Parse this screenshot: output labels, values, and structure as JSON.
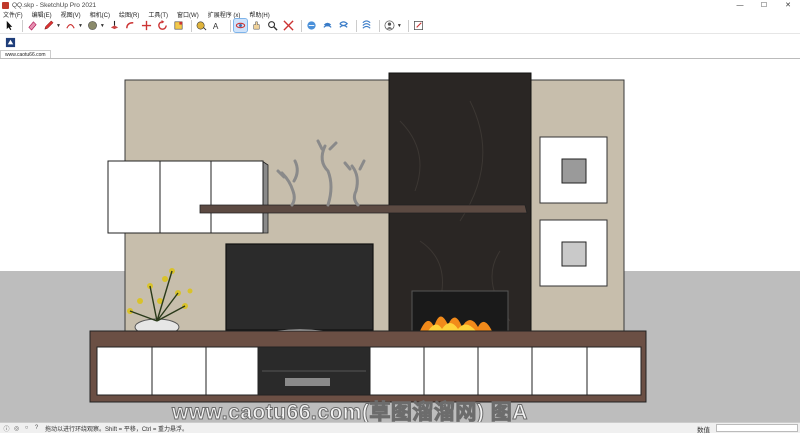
{
  "window": {
    "title": "QQ.skp - SketchUp Pro 2021",
    "controls": [
      "—",
      "☐",
      "✕"
    ]
  },
  "menu": [
    "文件(F)",
    "编辑(E)",
    "视图(V)",
    "相机(C)",
    "绘图(R)",
    "工具(T)",
    "窗口(W)",
    "扩展程序 (x)",
    "帮助(H)"
  ],
  "toolbar": {
    "row1": [
      "select-icon",
      "eraser-icon",
      "pencil-icon",
      "arc-icon",
      "shape-icon",
      "push-pull-icon",
      "follow-me-icon",
      "move-icon",
      "rotate-icon",
      "scale-icon",
      "tape-measure-icon",
      "text-icon",
      "orbit-icon",
      "pan-icon",
      "zoom-icon",
      "zoom-extents-icon",
      "warehouse-icon",
      "extension-warehouse-icon",
      "layout-icon",
      "styles-icon",
      "account-icon",
      "sketch-icon"
    ],
    "row2": [
      "component-icon"
    ]
  },
  "scene_tab": "www.caotu66.com",
  "status": {
    "hint": "拖动以进行环绕观察。Shift = 平移，Ctrl = 重力悬浮。",
    "measurements_label": "数值",
    "measurements_value": ""
  },
  "watermark": "www.caotu66.com(草图溜溜网) 图A",
  "colors": {
    "sky": "#ffffff",
    "ground": "#bdbdbd",
    "wall": "#c7beac",
    "marble": "#2a2624",
    "wood": "#6b4f44",
    "accent_select": "#cfe3fb"
  }
}
